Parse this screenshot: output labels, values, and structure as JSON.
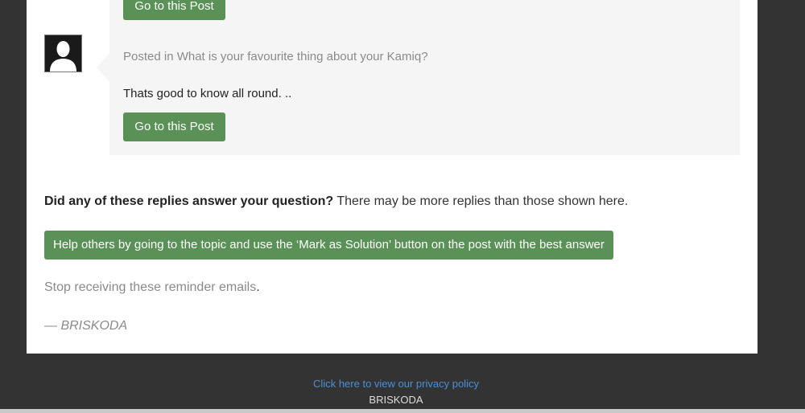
{
  "post": {
    "top_button_label": "Go to this Post",
    "posted_in": "Posted in What is your favourite thing about your Kamiq?",
    "reply_text": "Thats good to know all round. ..",
    "button_label": "Go to this Post",
    "avatar_icon": "user-silhouette-icon"
  },
  "question": {
    "bold": "Did any of these replies answer your question?",
    "rest": " There may be more replies than those shown here."
  },
  "help_button_label": "Help others by going to the topic and use the ‘Mark as Solution’ button on the post with the best answer",
  "stop": {
    "link": "Stop receiving these reminder emails",
    "period": "."
  },
  "signature": "— BRISKODA",
  "footer": {
    "privacy_link": "Click here to view our privacy policy",
    "brand": "BRISKODA"
  },
  "colors": {
    "button_green": "#5a9157",
    "background_dark": "#333333",
    "post_block_bg": "#f5f5f5",
    "link_blue": "#4a90d9"
  }
}
